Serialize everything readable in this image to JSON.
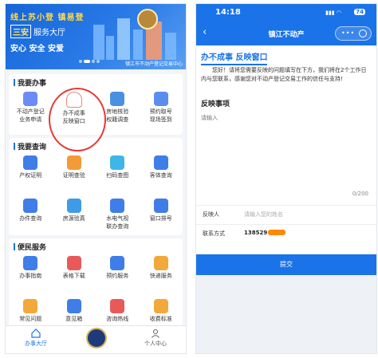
{
  "left": {
    "banner": {
      "headline": "线上苏小登  镇易登",
      "tag": "三安",
      "subtitle": "服务大厅",
      "slogan": "安心  安全  安爱",
      "caption": "镇江市不动产登记交易中心"
    },
    "sections": [
      {
        "title": "我要办事",
        "items": [
          {
            "label": "不动产登记\n业务申请",
            "icon": "document-edit-icon",
            "color": "#6c8cf5"
          },
          {
            "label": "办不成事\n反映窗口",
            "icon": "person-icon",
            "color": "#e58a7a"
          },
          {
            "label": "房地核验\n权籍调查",
            "icon": "building-icon",
            "color": "#4a90e2"
          },
          {
            "label": "预约取号\n现场签到",
            "icon": "calendar-icon",
            "color": "#5b8def"
          }
        ]
      },
      {
        "title": "我要查询",
        "items": [
          {
            "label": "产权证明",
            "icon": "certificate-icon",
            "color": "#3f7de8"
          },
          {
            "label": "证明查验",
            "icon": "verify-icon",
            "color": "#f29b38"
          },
          {
            "label": "扫码查图",
            "icon": "scan-icon",
            "color": "#3fb6e8"
          },
          {
            "label": "客体查询",
            "icon": "search-doc-icon",
            "color": "#3f7de8"
          },
          {
            "label": "办件查询",
            "icon": "list-search-icon",
            "color": "#3f7de8"
          },
          {
            "label": "房源验真",
            "icon": "shield-icon",
            "color": "#3f9be8"
          },
          {
            "label": "水电气视\n联办查询",
            "icon": "drop-icon",
            "color": "#3f7de8"
          },
          {
            "label": "窗口排号",
            "icon": "queue-icon",
            "color": "#3f7de8"
          }
        ]
      },
      {
        "title": "便民服务",
        "items": [
          {
            "label": "办事指南",
            "icon": "guide-icon",
            "color": "#3f7de8"
          },
          {
            "label": "表格下载",
            "icon": "download-icon",
            "color": "#e85a5a"
          },
          {
            "label": "预约服务",
            "icon": "appointment-icon",
            "color": "#3f7de8"
          },
          {
            "label": "快递服务",
            "icon": "package-icon",
            "color": "#f2a93b"
          },
          {
            "label": "常见问题",
            "icon": "question-icon",
            "color": "#f2a93b"
          },
          {
            "label": "意见箱",
            "icon": "mailbox-icon",
            "color": "#3f7de8"
          },
          {
            "label": "咨询热线",
            "icon": "headset-icon",
            "color": "#e85a5a"
          },
          {
            "label": "收费标准",
            "icon": "price-icon",
            "color": "#f2a93b"
          }
        ]
      }
    ],
    "tabbar": {
      "home": "办事大厅",
      "profile": "个人中心"
    }
  },
  "right": {
    "status": {
      "time": "14:18",
      "battery": "74"
    },
    "nav": {
      "title": "镇江不动产",
      "back": "‹",
      "more": "•••"
    },
    "window_title": "办不成事 反映窗口",
    "intro": "您好！请将您需要反映的问题填写在下方，我们将在2个工作日内与您联系，感谢您对不动产登记交易工作的信任与支持!",
    "feedback": {
      "label": "反映事项",
      "placeholder": "请输入",
      "counter": "0/200"
    },
    "reporter": {
      "label": "反映人",
      "placeholder": "请输入您的姓名"
    },
    "contact": {
      "label": "联系方式",
      "value": "138529"
    },
    "submit": "提交"
  }
}
